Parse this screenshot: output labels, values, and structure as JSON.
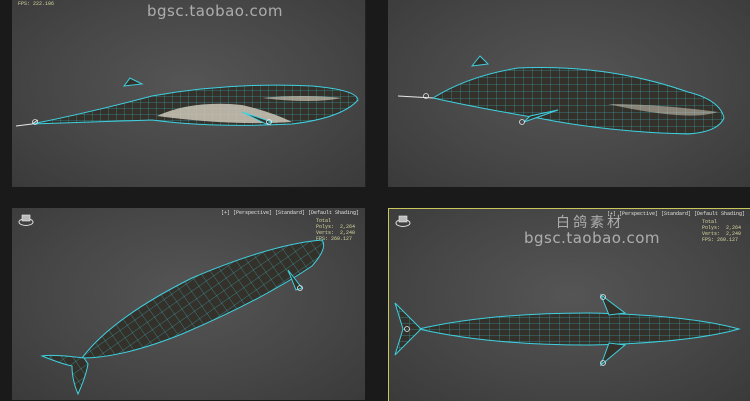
{
  "viewports": {
    "top_left": {
      "fps": "FPS: 222.106"
    },
    "top_right": {},
    "bottom_left": {
      "label": "[+] [Perspective] [Standard] [Default Shading]",
      "stats": {
        "name": "Total",
        "polys_label": "Polys:",
        "polys": "2,264",
        "verts_label": "Verts:",
        "verts": "2,240",
        "fps": "FPS: 260.127"
      }
    },
    "bottom_right": {
      "label": "[+] [Perspective] [Standard] [Default Shading]",
      "stats": {
        "name": "Total",
        "polys_label": "Polys:",
        "polys": "2,264",
        "verts_label": "Verts:",
        "verts": "2,240",
        "fps": "FPS: 260.127"
      }
    }
  },
  "watermark": {
    "top_url": "bgsc.taobao.com",
    "cn": "白鸽素材",
    "url": "bgsc.taobao.com"
  },
  "colors": {
    "wire": "#3fd0e0",
    "body": "#3a3528",
    "belly": "#d8d2c4",
    "accent_border": "#c8c85a"
  }
}
